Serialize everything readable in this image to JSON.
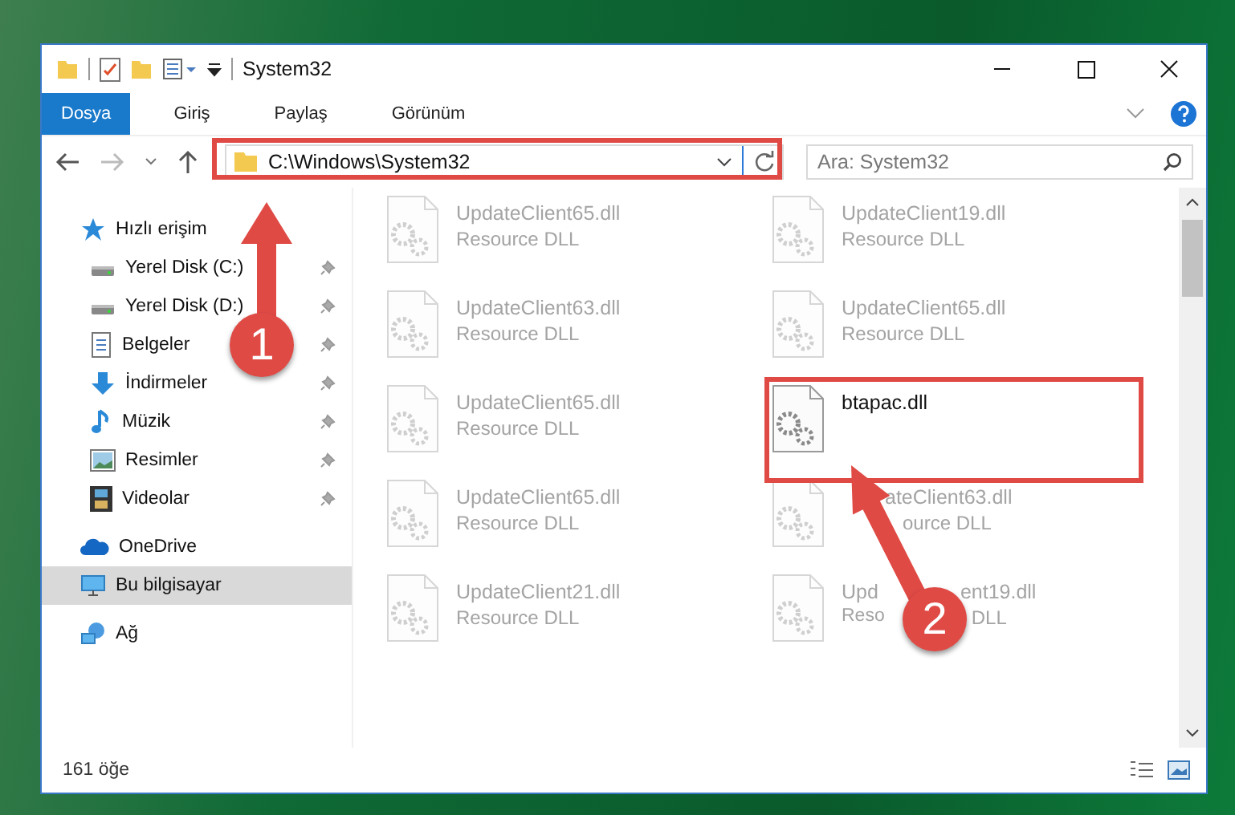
{
  "window": {
    "title": "System32"
  },
  "ribbon_tabs": [
    {
      "label": "Dosya",
      "selected": true
    },
    {
      "label": "Giriş",
      "selected": false
    },
    {
      "label": "Paylaş",
      "selected": false
    },
    {
      "label": "Görünüm",
      "selected": false
    }
  ],
  "address_bar": {
    "path": "C:\\Windows\\System32"
  },
  "search": {
    "placeholder": "Ara: System32"
  },
  "sidebar": {
    "items": [
      {
        "label": "Hızlı erişim",
        "kind": "star",
        "selected": false,
        "children": [
          {
            "label": "Yerel Disk (C:)",
            "kind": "drive",
            "pinned": true,
            "selected": false
          },
          {
            "label": "Yerel Disk (D:)",
            "kind": "drive",
            "pinned": true,
            "selected": false
          },
          {
            "label": "Belgeler",
            "kind": "document",
            "pinned": true,
            "selected": false
          },
          {
            "label": "İndirmeler",
            "kind": "download",
            "pinned": true,
            "selected": false
          },
          {
            "label": "Müzik",
            "kind": "music",
            "pinned": true,
            "selected": false
          },
          {
            "label": "Resimler",
            "kind": "pictures",
            "pinned": true,
            "selected": false
          },
          {
            "label": "Videolar",
            "kind": "video",
            "pinned": true,
            "selected": false
          }
        ]
      },
      {
        "label": "OneDrive",
        "kind": "cloud",
        "selected": false
      },
      {
        "label": "Bu bilgisayar",
        "kind": "computer",
        "selected": true
      },
      {
        "label": "Ağ",
        "kind": "network",
        "selected": false
      }
    ]
  },
  "files": [
    {
      "name": "UpdateClient65.dll",
      "type": "Resource DLL",
      "blurred": true
    },
    {
      "name": "UpdateClient19.dll",
      "type": "Resource DLL",
      "blurred": true
    },
    {
      "name": "UpdateClient63.dll",
      "type": "Resource DLL",
      "blurred": true
    },
    {
      "name": "UpdateClient65.dll",
      "type": "Resource DLL",
      "blurred": true
    },
    {
      "name": "UpdateClient65.dll",
      "type": "Resource DLL",
      "blurred": true
    },
    {
      "name": "btapac.dll",
      "blurred": false
    },
    {
      "name": "UpdateClient65.dll",
      "type": "Resource DLL",
      "blurred": true
    },
    {
      "name_cont": "ateClient63.dll",
      "type_cont": "ource DLL",
      "blurred": true
    },
    {
      "name": "UpdateClient21.dll",
      "type": "Resource DLL",
      "blurred": true
    },
    {
      "name": "Upd",
      "name_cont": "ent19.dll",
      "type": "Reso",
      "type_cont": "DLL",
      "blurred": true
    }
  ],
  "status_bar": {
    "count": "161 öğe"
  },
  "callouts": [
    {
      "number": "1"
    },
    {
      "number": "2"
    }
  ]
}
